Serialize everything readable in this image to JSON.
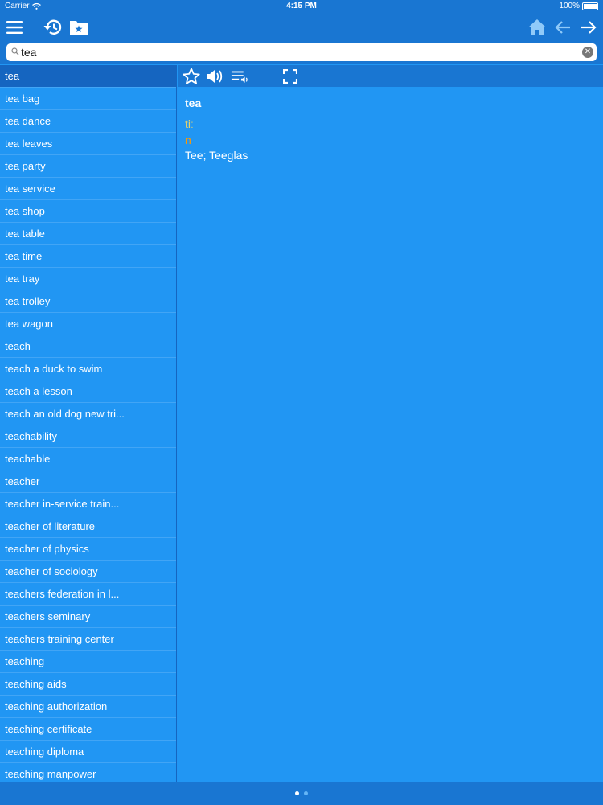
{
  "status": {
    "carrier": "Carrier",
    "time": "4:15 PM",
    "battery": "100%"
  },
  "toolbar": {
    "icons": [
      "menu-icon",
      "history-icon",
      "bookmark-folder-icon",
      "home-icon",
      "back-icon",
      "forward-icon"
    ]
  },
  "search": {
    "value": "tea"
  },
  "list": {
    "items": [
      "tea",
      "tea bag",
      "tea dance",
      "tea leaves",
      "tea party",
      "tea service",
      "tea shop",
      "tea table",
      "tea time",
      "tea tray",
      "tea trolley",
      "tea wagon",
      "teach",
      "teach a duck to swim",
      "teach a lesson",
      "teach an old dog new tri...",
      "teachability",
      "teachable",
      "teacher",
      "teacher in-service train...",
      "teacher of literature",
      "teacher of physics",
      "teacher of sociology",
      "teachers federation in l...",
      "teachers seminary",
      "teachers training center",
      "teaching",
      "teaching aids",
      "teaching authorization",
      "teaching certificate",
      "teaching diploma",
      "teaching manpower"
    ],
    "selected_index": 0
  },
  "entry": {
    "word": "tea",
    "pronunciation": "tiː",
    "part_of_speech": "n",
    "translation": "Tee; Teeglas"
  },
  "pager": {
    "current": 1,
    "total": 2
  },
  "colors": {
    "bar": "#1976d2",
    "content": "#2196f3",
    "selected_row": "#1565c0",
    "pronunciation": "#e6d36e",
    "part_of_speech": "#ff9800"
  }
}
